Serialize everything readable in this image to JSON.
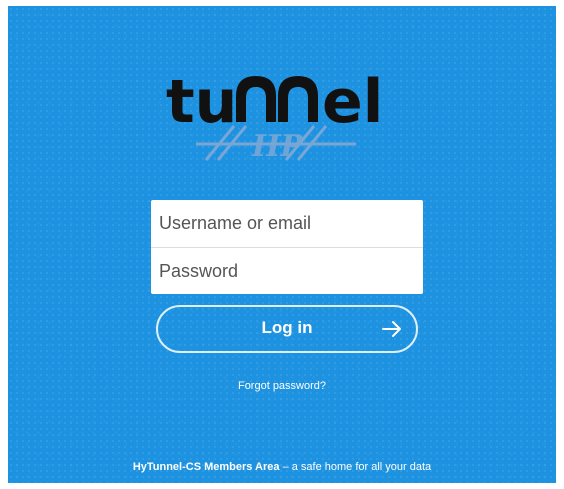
{
  "brand": {
    "logo_text": "tuNNel",
    "logo_sub": "HP",
    "colors": {
      "background": "#1d92e0",
      "logo_text": "#111111",
      "logo_stripe": "#7aa6d6"
    }
  },
  "login": {
    "username_placeholder": "Username or email",
    "password_placeholder": "Password",
    "button_label": "Log in",
    "button_icon": "arrow-right-icon",
    "forgot_label": "Forgot password?"
  },
  "footer": {
    "strong": "HyTunnel-CS Members Area",
    "rest": " – a safe home for all your data"
  }
}
